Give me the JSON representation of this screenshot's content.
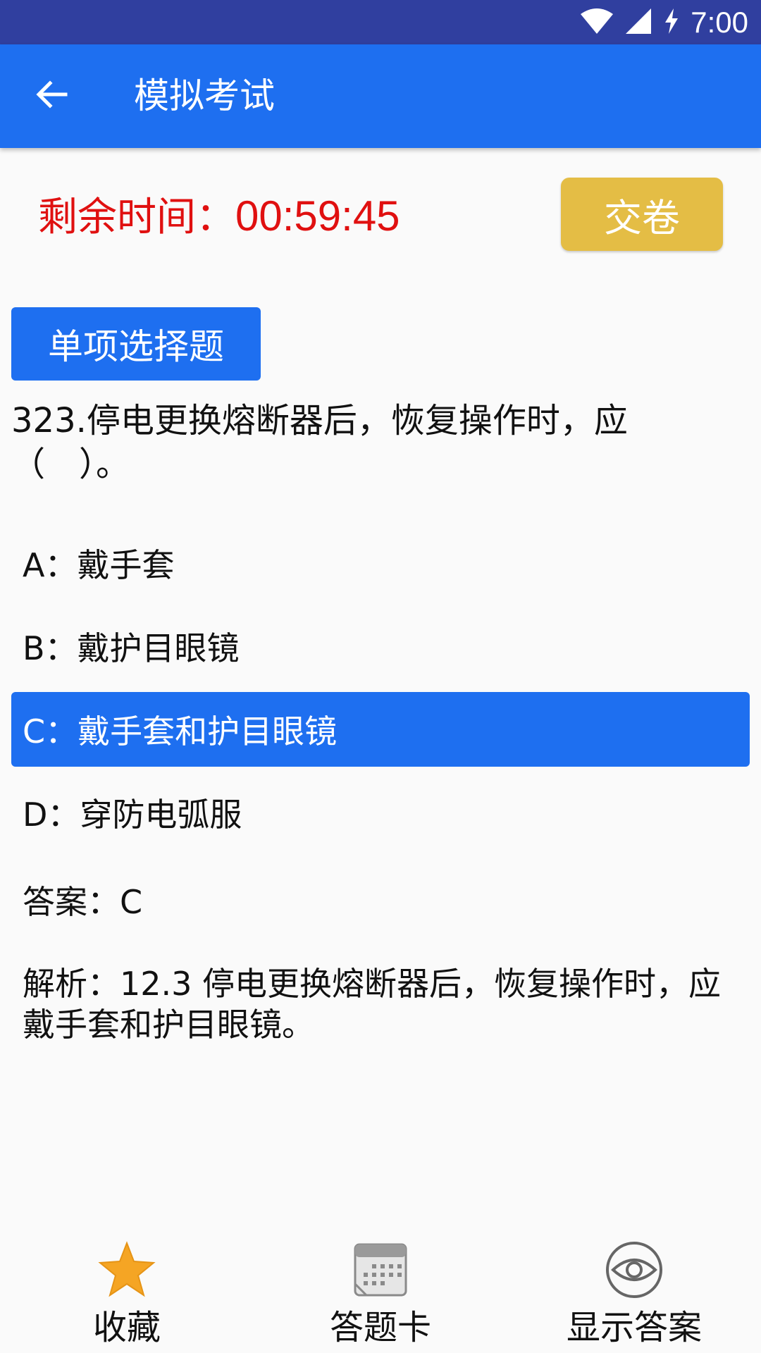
{
  "status_bar": {
    "time": "7:00",
    "icons": [
      "wifi-icon",
      "signal-icon",
      "battery-charging-icon"
    ]
  },
  "app_bar": {
    "title": "模拟考试",
    "back_icon": "arrow-left-icon"
  },
  "timer": {
    "label": "剩余时间：",
    "value": "00:59:45"
  },
  "submit_button": {
    "label": "交卷"
  },
  "question_type": "单项选择题",
  "question": {
    "text": "323.停电更换熔断器后，恢复操作时，应（　）。"
  },
  "options": [
    {
      "label": "A：戴手套",
      "selected": false
    },
    {
      "label": "B：戴护目眼镜",
      "selected": false
    },
    {
      "label": "C：戴手套和护目眼镜",
      "selected": true
    },
    {
      "label": "D：穿防电弧服",
      "selected": false
    }
  ],
  "answer": "答案：C",
  "analysis": "解析：12.3  停电更换熔断器后，恢复操作时，应戴手套和护目眼镜。",
  "bottom_nav": [
    {
      "label": "收藏",
      "icon": "star-icon"
    },
    {
      "label": "答题卡",
      "icon": "calendar-icon"
    },
    {
      "label": "显示答案",
      "icon": "eye-icon"
    }
  ],
  "colors": {
    "status_bar": "#303f9f",
    "primary": "#1e6ff0",
    "timer": "#e01010",
    "submit": "#e4bd45",
    "star": "#f5a524"
  }
}
